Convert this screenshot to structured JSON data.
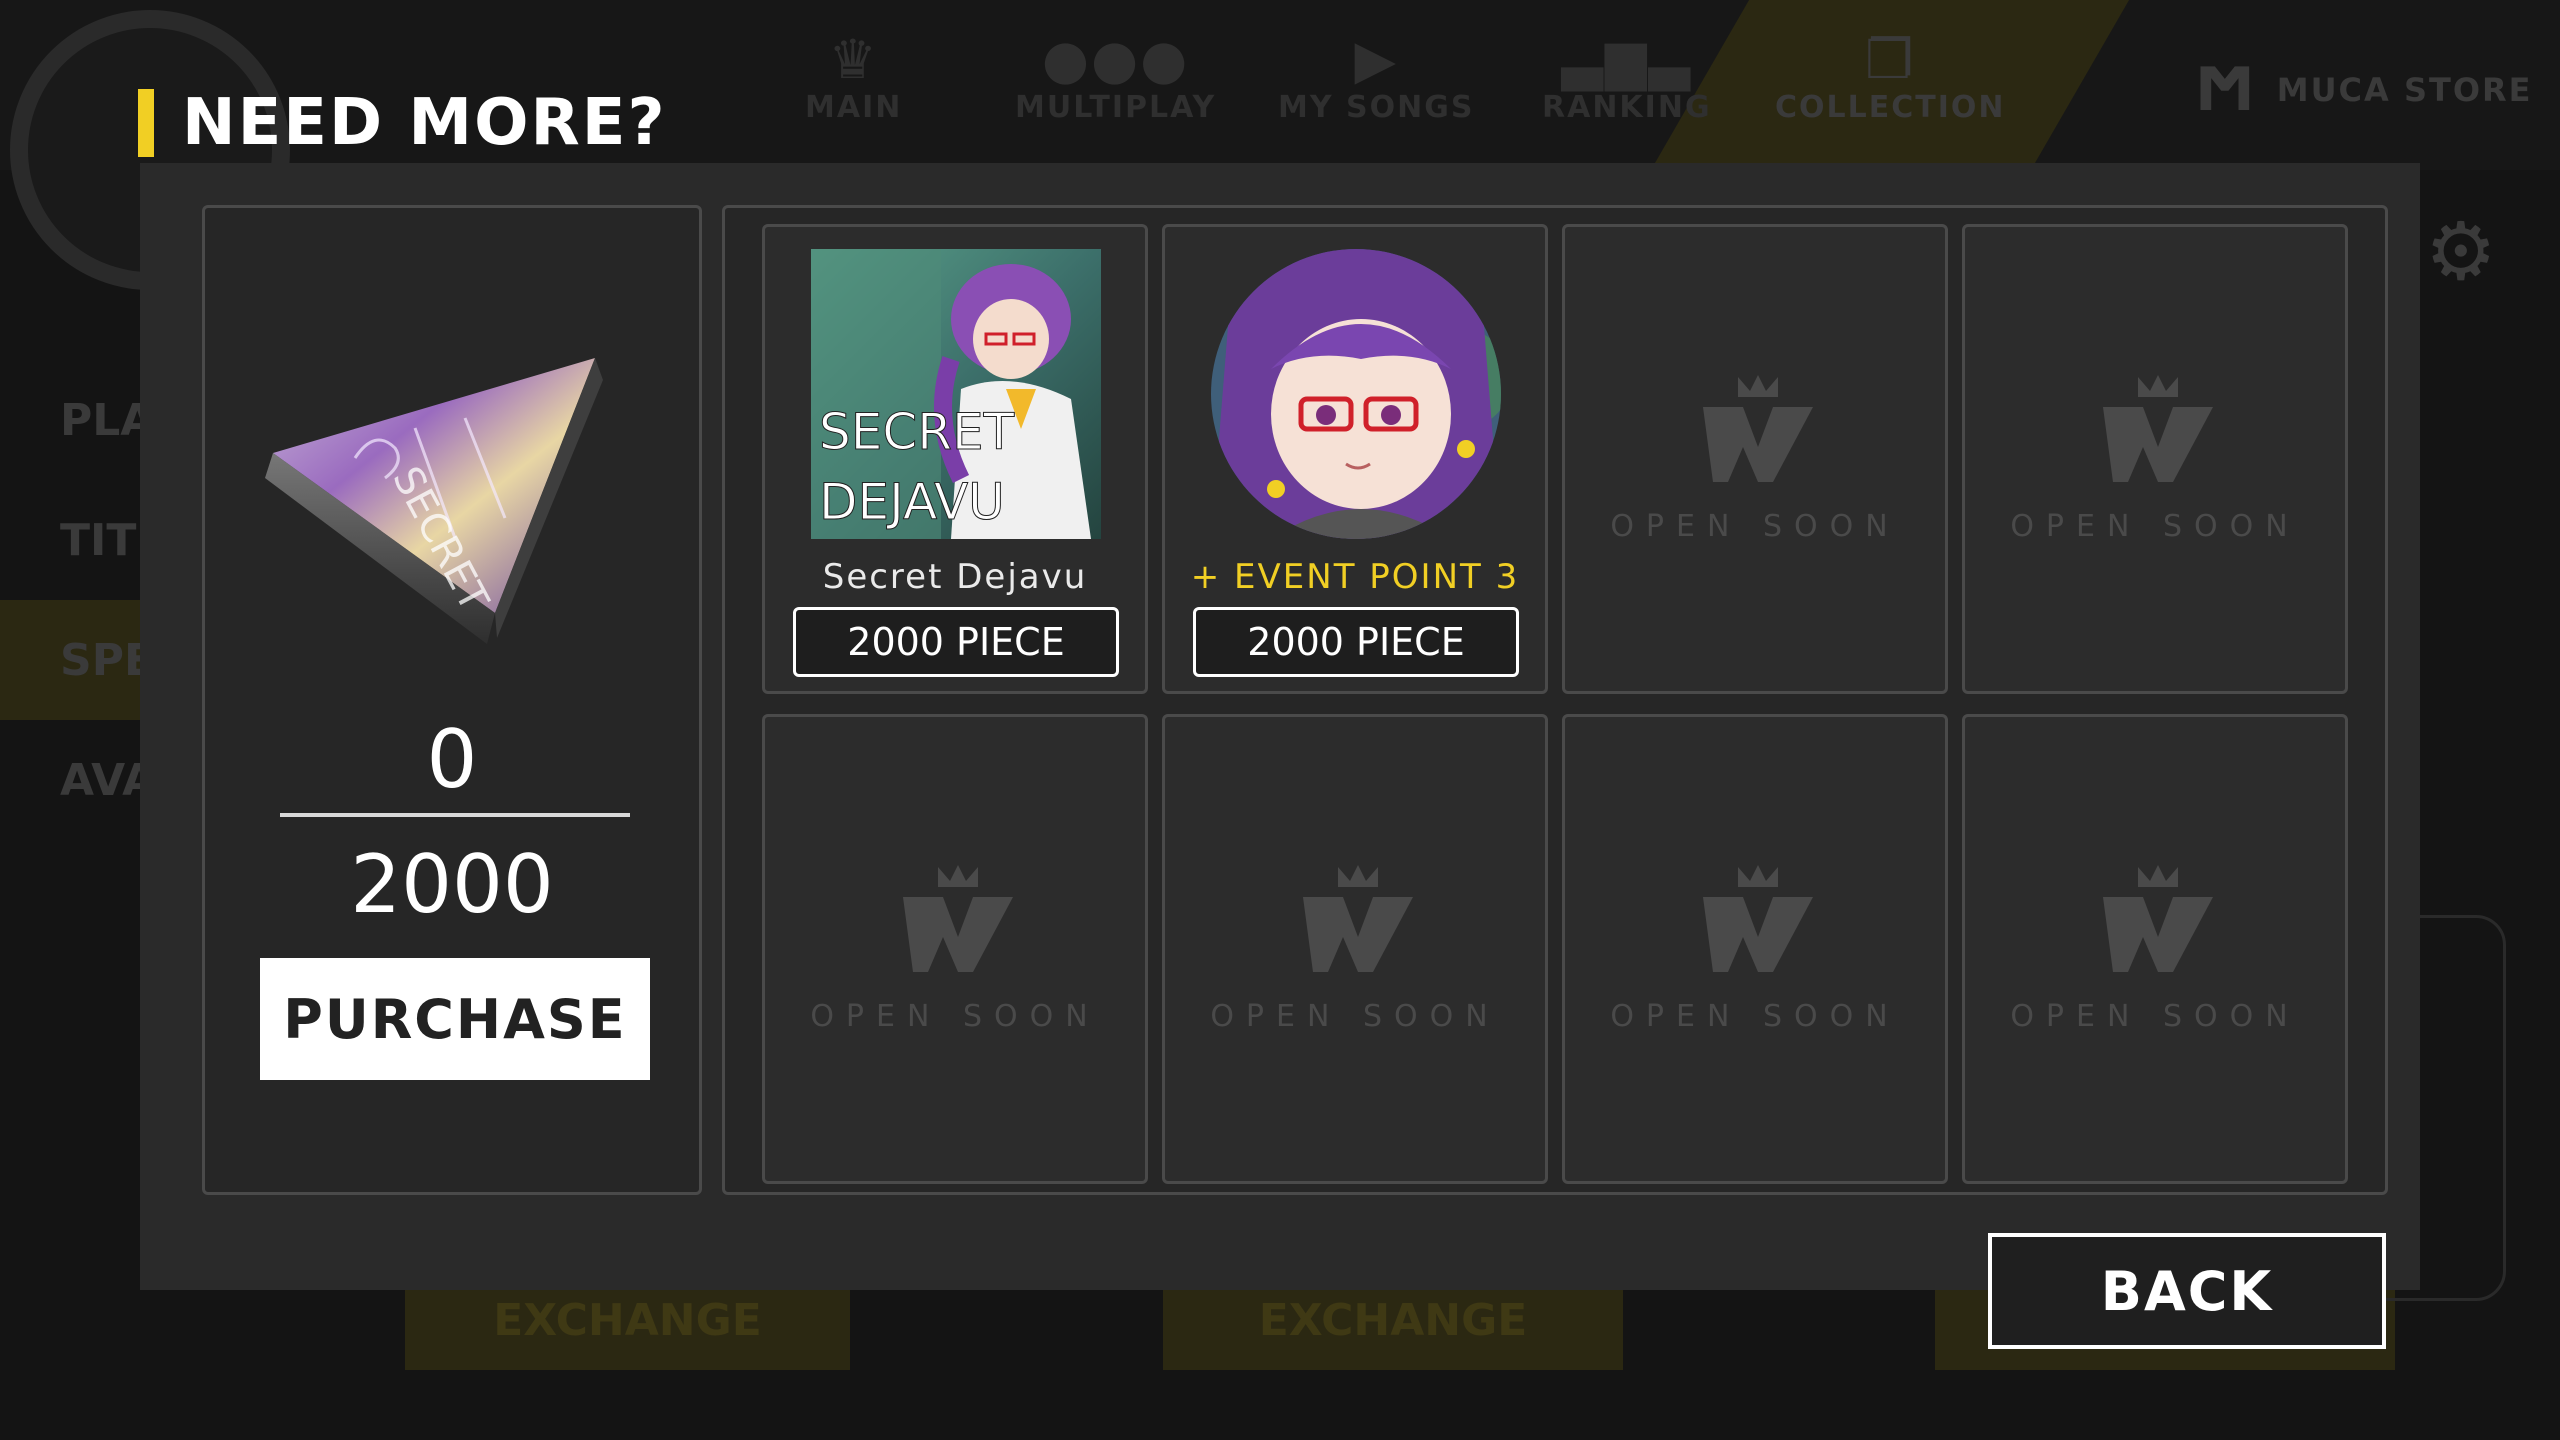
{
  "background": {
    "nav": [
      {
        "label": "MAIN",
        "icon": "crown-logo-icon"
      },
      {
        "label": "MULTIPLAY",
        "icon": "people-icon"
      },
      {
        "label": "MY SONGS",
        "icon": "play-icon"
      },
      {
        "label": "RANKING",
        "icon": "podium-icon"
      },
      {
        "label": "COLLECTION",
        "icon": "cards-icon"
      }
    ],
    "store_label": "MUCA STORE",
    "sidebar": [
      "PLA",
      "TITL",
      "SPE",
      "AVA"
    ],
    "exchange_label": "EXCHANGE"
  },
  "modal": {
    "title": "NEED MORE?",
    "piece": {
      "owned": "0",
      "required": "2000",
      "purchase_label": "PURCHASE"
    },
    "items": [
      {
        "type": "song",
        "label": "Secret Dejavu",
        "price": "2000 PIECE",
        "art_text_1": "SECRET",
        "art_text_2": "DEJAVU"
      },
      {
        "type": "event",
        "label": "+ EVENT POINT 3",
        "price": "2000 PIECE"
      }
    ],
    "placeholder_label": "OPEN SOON",
    "back_label": "BACK"
  },
  "colors": {
    "accent": "#f1cf24",
    "panel": "#2a2a2a",
    "border": "#4a4a4a"
  }
}
